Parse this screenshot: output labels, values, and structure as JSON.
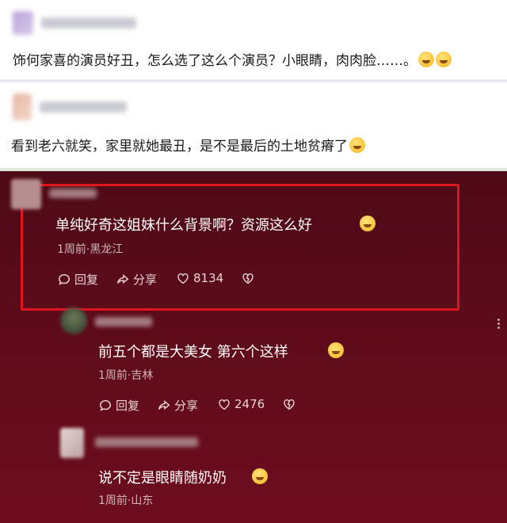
{
  "posts": [
    {
      "text": "饰何家喜的演员好丑，怎么选了这么个演员？小眼睛，肉肉脸……。",
      "emojis": [
        "grin-emoji",
        "grin-emoji"
      ]
    },
    {
      "text": "看到老六就笑，家里就她最丑，是不是最后的土地贫瘠了",
      "emojis": [
        "laugh-emoji"
      ]
    }
  ],
  "comments": [
    {
      "text": "单纯好奇这姐妹什么背景啊？资源这么好",
      "meta": "1周前·黑龙江",
      "reply": "回复",
      "share": "分享",
      "likes": "8134"
    },
    {
      "text": "前五个都是大美女  第六个这样",
      "meta": "1周前·吉林",
      "reply": "回复",
      "share": "分享",
      "likes": "2476"
    },
    {
      "text": "说不定是眼睛随奶奶",
      "meta": "1周前·山东"
    }
  ],
  "colors": {
    "highlight": "#e0141d",
    "dark_bg": "#5c0b1a"
  }
}
